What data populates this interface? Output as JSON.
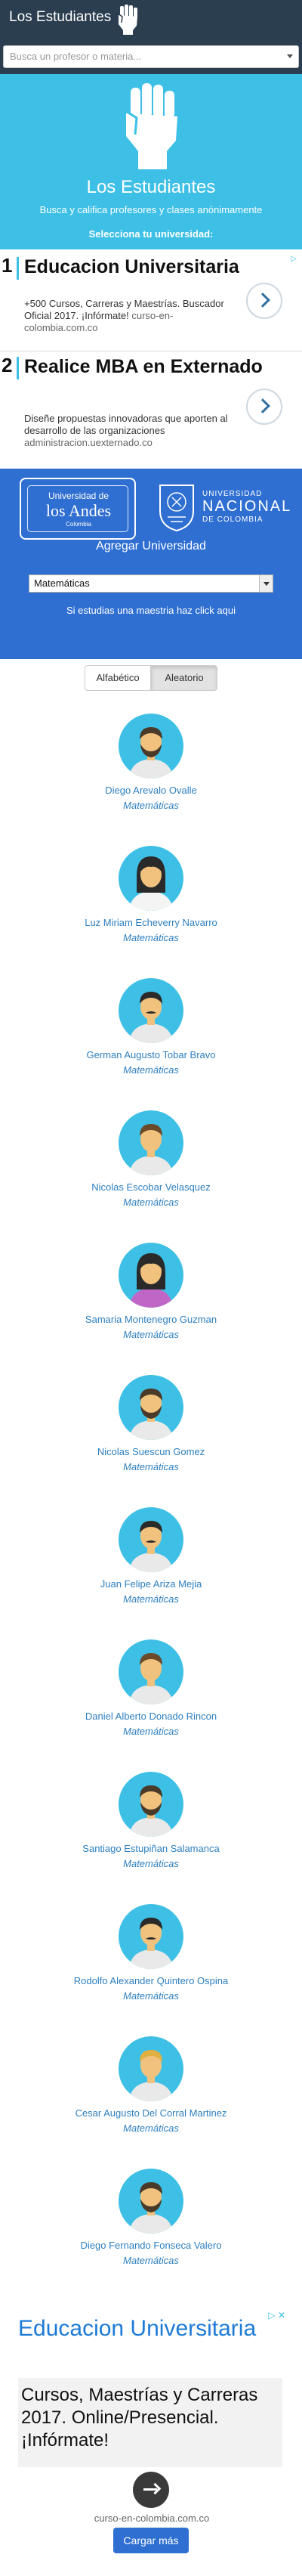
{
  "navbar": {
    "brand": "Los Estudiantes"
  },
  "search": {
    "placeholder": "Busca un profesor o materia..."
  },
  "hero": {
    "title": "Los Estudiantes",
    "subtitle": "Busca y califica profesores y clases anónimamente",
    "select_prompt": "Selecciona tu universidad:"
  },
  "ads": [
    {
      "number": "1",
      "title": "Educacion Universitaria",
      "description": "+500 Cursos, Carreras y Maestrías. Buscador Oficial 2017. ¡Infórmate!",
      "url": "curso-en-colombia.com.co"
    },
    {
      "number": "2",
      "title": "Realice MBA en Externado",
      "description": "Diseñe propuestas innovadoras que aporten al desarrollo de las organizaciones",
      "url": "administracion.uexternado.co"
    }
  ],
  "universities": {
    "andes": {
      "line1": "Universidad de",
      "line2": "los Andes",
      "line3": "Colombia"
    },
    "unal": {
      "line1": "UNIVERSIDAD",
      "line2": "NACIONAL",
      "line3": "DE COLOMBIA"
    },
    "add_label": "Agregar Universidad",
    "selected_option": "Matemáticas",
    "maestria_link": "Si estudias una maestria haz click aqui"
  },
  "sort": {
    "alpha": "Alfabético",
    "random": "Aleatorio"
  },
  "professors": [
    {
      "name": "Diego Arevalo Ovalle",
      "subject": "Matemáticas",
      "avatar": "man-beard"
    },
    {
      "name": "Luz Miriam Echeverry Navarro",
      "subject": "Matemáticas",
      "avatar": "woman-dark-hair"
    },
    {
      "name": "German Augusto Tobar Bravo",
      "subject": "Matemáticas",
      "avatar": "man-mustache"
    },
    {
      "name": "Nicolas Escobar Velasquez",
      "subject": "Matemáticas",
      "avatar": "man-hair"
    },
    {
      "name": "Samaria Montenegro Guzman",
      "subject": "Matemáticas",
      "avatar": "woman-purple"
    },
    {
      "name": "Nicolas Suescun Gomez",
      "subject": "Matemáticas",
      "avatar": "man-beard"
    },
    {
      "name": "Juan Felipe Ariza Mejia",
      "subject": "Matemáticas",
      "avatar": "man-mustache"
    },
    {
      "name": "Daniel Alberto Donado Rincon",
      "subject": "Matemáticas",
      "avatar": "man-hair"
    },
    {
      "name": "Santiago Estupiñan Salamanca",
      "subject": "Matemáticas",
      "avatar": "man-beard"
    },
    {
      "name": "Rodolfo Alexander Quintero Ospina",
      "subject": "Matemáticas",
      "avatar": "man-mustache"
    },
    {
      "name": "Cesar Augusto Del Corral Martinez",
      "subject": "Matemáticas",
      "avatar": "man-blond"
    },
    {
      "name": "Diego Fernando Fonseca Valero",
      "subject": "Matemáticas",
      "avatar": "man-beard"
    }
  ],
  "bottom_ad": {
    "title": "Educacion Universitaria",
    "description": "Cursos, Maestrías y Carreras 2017. Online/Presencial. ¡Infórmate!",
    "url": "curso-en-colombia.com.co"
  },
  "load_more": "Cargar más",
  "colors": {
    "navbar": "#2b3e50",
    "hero": "#3ec0e6",
    "university_panel": "#2f6fd1",
    "link": "#2d7fc0"
  }
}
